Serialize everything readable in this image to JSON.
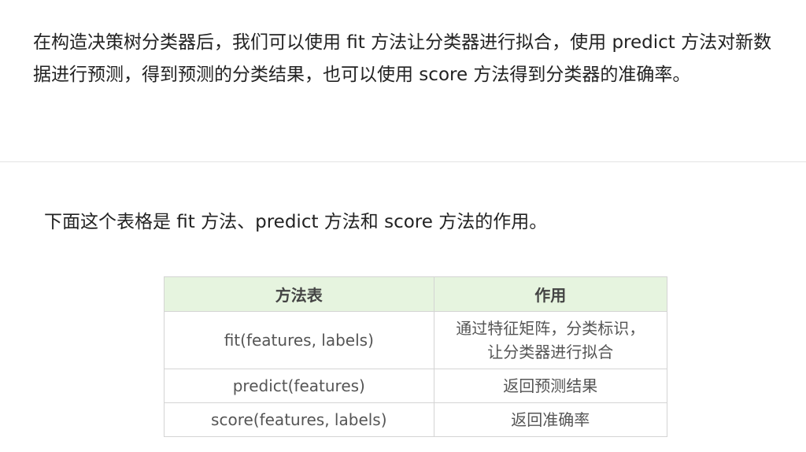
{
  "intro_paragraph": "在构造决策树分类器后，我们可以使用 fit 方法让分类器进行拟合，使用 predict 方法对新数据进行预测，得到预测的分类结果，也可以使用 score 方法得到分类器的准确率。",
  "table_intro": "下面这个表格是 fit 方法、predict 方法和 score 方法的作用。",
  "table": {
    "headers": [
      "方法表",
      "作用"
    ],
    "rows": [
      {
        "method": "fit(features, labels)",
        "use_line1": "通过特征矩阵，分类标识，",
        "use_line2": "让分类器进行拟合"
      },
      {
        "method": "predict(features)",
        "use_line1": "返回预测结果",
        "use_line2": ""
      },
      {
        "method": "score(features, labels)",
        "use_line1": "返回准确率",
        "use_line2": ""
      }
    ]
  },
  "colors": {
    "header_bg": "#e6f4df",
    "border": "#d4d4d4",
    "text": "#222222",
    "table_text": "#555555"
  }
}
